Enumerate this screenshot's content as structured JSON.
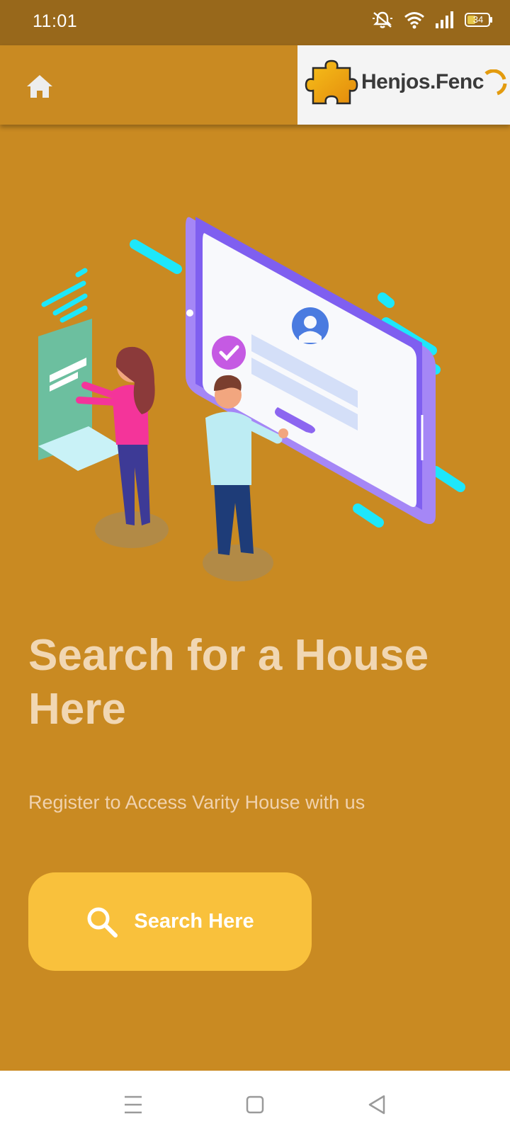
{
  "status_bar": {
    "time": "11:01",
    "battery": "34",
    "icons": [
      "mute-icon",
      "wifi-icon",
      "signal-icon",
      "battery-icon"
    ]
  },
  "header": {
    "home_icon": "home-icon",
    "logo_text": "Henjos.Fenc",
    "logo_icon": "puzzle-icon"
  },
  "hero": {
    "headline": "Search for a House Here",
    "subtitle": "Register to Access Varity House with us"
  },
  "search_button": {
    "label": "Search Here",
    "icon": "search-icon"
  },
  "nav_bar": {
    "items": [
      "menu-icon",
      "home-square-icon",
      "back-icon"
    ]
  },
  "colors": {
    "background": "#C98A22",
    "status_bar": "#98681B",
    "headline": "#F1D7B3",
    "button": "#F9C13C",
    "logo_bg": "#F4F4F4"
  }
}
